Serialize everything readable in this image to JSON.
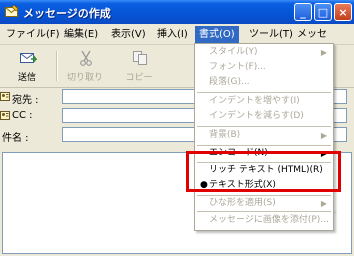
{
  "window": {
    "title": "メッセージの作成",
    "controls": {
      "minimize": "_",
      "maximize": "□",
      "close": "×"
    }
  },
  "menubar": {
    "items": [
      {
        "label": "ファイル(F)"
      },
      {
        "label": "編集(E)"
      },
      {
        "label": "表示(V)"
      },
      {
        "label": "挿入(I)"
      },
      {
        "label": "書式(O)"
      },
      {
        "label": "ツール(T)"
      },
      {
        "label": "メッセ"
      }
    ]
  },
  "toolbar": {
    "send": {
      "label": "送信",
      "icon": "send-mail-icon"
    },
    "cut": {
      "label": "切り取り",
      "icon": "scissors-icon"
    },
    "copy": {
      "label": "コピー",
      "icon": "copy-icon"
    }
  },
  "fields": {
    "to": {
      "label": "宛先 :",
      "value": ""
    },
    "cc": {
      "label": "CC :",
      "value": ""
    },
    "subject": {
      "label": "件名 :",
      "value": ""
    }
  },
  "format_menu": {
    "items": [
      {
        "label": "スタイル(Y)",
        "submenu": true,
        "enabled": false
      },
      {
        "label": "フォント(F)...",
        "enabled": false
      },
      {
        "label": "段落(G)...",
        "enabled": false
      },
      {
        "label": "インデントを増やす(I)",
        "enabled": false
      },
      {
        "label": "インデントを減らす(D)",
        "enabled": false
      },
      {
        "label": "背景(B)",
        "submenu": true,
        "enabled": false
      },
      {
        "label": "エンコード(N)",
        "submenu": true,
        "enabled": true
      },
      {
        "label": "リッチ テキスト (HTML)(R)",
        "enabled": true
      },
      {
        "label": "テキスト形式(X)",
        "enabled": true,
        "checked": true
      },
      {
        "label": "ひな形を適用(S)",
        "submenu": true,
        "enabled": false
      },
      {
        "label": "メッセージに画像を添付(P)...",
        "enabled": false
      }
    ],
    "bullet": "●",
    "arrow": "▶"
  },
  "colors": {
    "titlebar": "#0a5fe0",
    "menu_highlight": "#316ac5",
    "highlight_box": "#e00000"
  }
}
